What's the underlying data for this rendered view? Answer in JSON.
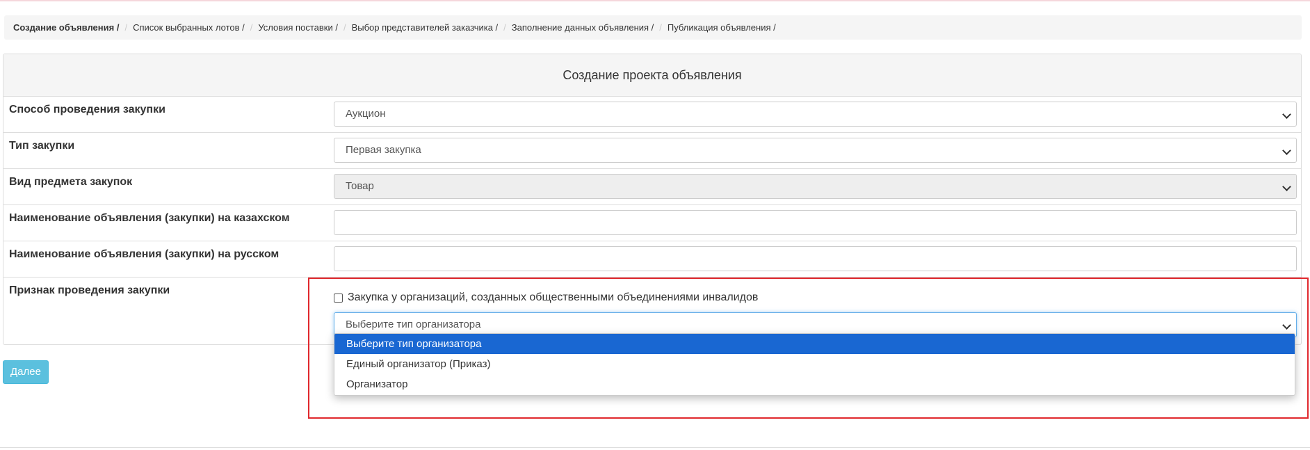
{
  "breadcrumb": [
    "Создание объявления /",
    "Список выбранных лотов /",
    "Условия поставки /",
    "Выбор представителей заказчика /",
    "Заполнение данных объявления /",
    "Публикация объявления /"
  ],
  "breadcrumb_separator": "/",
  "panel": {
    "title": "Создание проекта объявления"
  },
  "form": {
    "method": {
      "label": "Способ проведения закупки",
      "value": "Аукцион"
    },
    "type": {
      "label": "Тип закупки",
      "value": "Первая закупка"
    },
    "subject": {
      "label": "Вид предмета закупок",
      "value": "Товар"
    },
    "name_kz": {
      "label": "Наименование объявления (закупки) на казахском",
      "value": ""
    },
    "name_ru": {
      "label": "Наименование объявления (закупки) на русском",
      "value": ""
    },
    "sign": {
      "label": "Признак проведения закупки",
      "checkbox_label": "Закупка у организаций, созданных общественными объединениями инвалидов",
      "checked": false,
      "organizer_select": "Выберите тип организатора"
    }
  },
  "dropdown": {
    "options": [
      "Выберите тип организатора",
      "Единый организатор (Приказ)",
      "Организатор"
    ],
    "selected_index": 0
  },
  "buttons": {
    "next": "Далее"
  },
  "colors": {
    "highlight": "#e0282d",
    "selected_option": "#1967d2",
    "next_button": "#5bc0de"
  },
  "icons": [
    "chevron-down-icon",
    "checkbox-icon"
  ]
}
